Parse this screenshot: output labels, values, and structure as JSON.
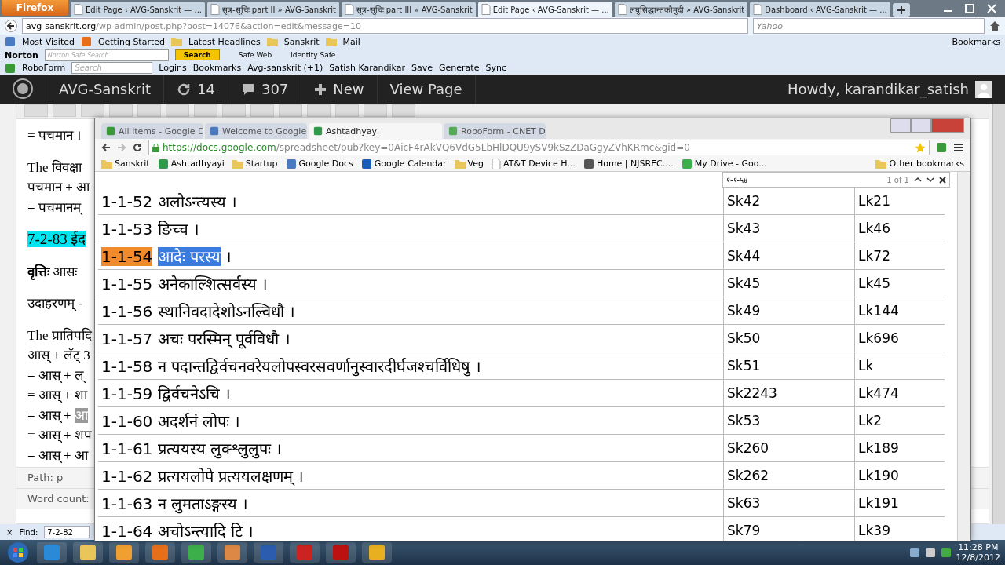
{
  "firefox": {
    "menu_button": "Firefox",
    "tabs": [
      {
        "label": "Edit Page ‹ AVG-Sanskrit — ...",
        "selected": false
      },
      {
        "label": "सूत्र-सूचिः part II » AVG-Sanskrit",
        "selected": false
      },
      {
        "label": "सूत्र-सूचिः part III » AVG-Sanskrit",
        "selected": false
      },
      {
        "label": "Edit Page ‹ AVG-Sanskrit — ...",
        "selected": true
      },
      {
        "label": "लघुसिद्धान्तकौमुदी » AVG-Sanskrit",
        "selected": false
      },
      {
        "label": "Dashboard ‹ AVG-Sanskrit — ...",
        "selected": false
      }
    ],
    "url_host": "avg-sanskrit.org",
    "url_path": "/wp-admin/post.php?post=14076&action=edit&message=10",
    "search_placeholder": "Yahoo",
    "bookmarks": [
      "Most Visited",
      "Getting Started",
      "Latest Headlines",
      "Sanskrit",
      "Mail"
    ],
    "bookmarks_menu": "Bookmarks",
    "norton": {
      "label": "Norton",
      "placeholder": "Norton Safe Search",
      "search_button": "Search",
      "items": [
        "Safe Web",
        "Identity Safe"
      ]
    },
    "roboform": {
      "label": "RoboForm",
      "placeholder": "Search",
      "items": [
        "Logins",
        "Bookmarks",
        "Avg-sanskrit (+1)",
        "Satish Karandikar",
        "Save",
        "Generate",
        "Sync"
      ]
    }
  },
  "admin_bar": {
    "site": "AVG-Sanskrit",
    "updates": "14",
    "comments": "307",
    "new": "New",
    "view": "View Page",
    "howdy": "Howdy, karandikar_satish"
  },
  "editor": {
    "paragraphs": [
      {
        "lines": [
          {
            "text": "= पचमान ।",
            "kind": "plain"
          }
        ]
      },
      {
        "lines": [
          {
            "text": "The विवक्षा",
            "kind": "plain"
          },
          {
            "text": "पचमान + आ",
            "kind": "plain"
          },
          {
            "text": "= पचमानम्",
            "kind": "plain"
          }
        ]
      },
      {
        "lines": [
          {
            "text": "7-2-83 ईद",
            "kind": "highlight"
          }
        ]
      },
      {
        "lines": [
          {
            "text": "**वृत्तिः** आसः",
            "kind": "plain"
          }
        ]
      },
      {
        "lines": [
          {
            "text": "उदाहरणम् -",
            "kind": "plain"
          }
        ]
      },
      {
        "lines": [
          {
            "text": "The प्रातिपदि",
            "kind": "plain"
          },
          {
            "text": "आस् + लँट् 3",
            "kind": "plain"
          },
          {
            "text": "= आस् + ल्",
            "kind": "plain"
          },
          {
            "text": "= आस् + शा",
            "kind": "plain"
          },
          {
            "text": "= आस् +",
            "marked": "आ",
            "kind": "plain"
          },
          {
            "text": "= आस् + शप",
            "kind": "plain"
          },
          {
            "text": "= आस् + आ",
            "kind": "plain"
          }
        ]
      }
    ],
    "path": "Path: p",
    "word_count": "Word count:"
  },
  "find_bar": {
    "close": "×",
    "label": "Find:",
    "value": "7-2-82"
  },
  "chrome": {
    "tabs": [
      {
        "label": "All items - Google D",
        "selected": false
      },
      {
        "label": "Welcome to Google",
        "selected": false
      },
      {
        "label": "Ashtadhyayi",
        "selected": true
      },
      {
        "label": "RoboForm - CNET D",
        "selected": false
      }
    ],
    "url_host": "https://docs.google.com",
    "url_path": "/spreadsheet/pub?key=0AicF4rAkVQ6VdG5LbHlDQU9ySV9kSzZDaGgyZVhKRmc&gid=0",
    "bookmarks": [
      "Sanskrit",
      "Ashtadhyayi",
      "Startup",
      "Google Docs",
      "Google Calendar",
      "Veg",
      "AT&T Device H...",
      "Home | NJSREC....",
      "My Drive - Goo..."
    ],
    "other_bookmarks": "Other bookmarks",
    "find": {
      "value": "१-१-५४",
      "count": "1 of 1"
    },
    "rows": [
      {
        "number": "1-1-52",
        "sutra": "अलोऽन्त्यस्य",
        "end": "।",
        "sk": "Sk42",
        "lk": "Lk21",
        "selected": false
      },
      {
        "number": "1-1-53",
        "sutra": "ङिच्च",
        "end": "।",
        "sk": "Sk43",
        "lk": "Lk46",
        "selected": false
      },
      {
        "number": "1-1-54",
        "sutra": "आदेः परस्य",
        "end": "।",
        "sk": "Sk44",
        "lk": "Lk72",
        "selected": true
      },
      {
        "number": "1-1-55",
        "sutra": "अनेकाल्शित्सर्वस्य",
        "end": "।",
        "sk": "Sk45",
        "lk": "Lk45",
        "selected": false
      },
      {
        "number": "1-1-56",
        "sutra": "स्थानिवदादेशोऽनल्विधौ",
        "end": "।",
        "sk": "Sk49",
        "lk": "Lk144",
        "selected": false
      },
      {
        "number": "1-1-57",
        "sutra": "अचः परस्मिन् पूर्वविधौ",
        "end": "।",
        "sk": "Sk50",
        "lk": "Lk696",
        "selected": false
      },
      {
        "number": "1-1-58",
        "sutra": "न पदान्तद्विर्वचनवरेयलोपस्वरसवर्णानुस्वारदीर्घजश्चर्विधिषु",
        "end": "।",
        "sk": "Sk51",
        "lk": "Lk",
        "selected": false
      },
      {
        "number": "1-1-59",
        "sutra": "द्विर्वचनेऽचि",
        "end": "।",
        "sk": "Sk2243",
        "lk": "Lk474",
        "selected": false
      },
      {
        "number": "1-1-60",
        "sutra": "अदर्शनं लोपः",
        "end": "।",
        "sk": "Sk53",
        "lk": "Lk2",
        "selected": false
      },
      {
        "number": "1-1-61",
        "sutra": "प्रत्ययस्य लुक्श्लुलुपः",
        "end": "।",
        "sk": "Sk260",
        "lk": "Lk189",
        "selected": false
      },
      {
        "number": "1-1-62",
        "sutra": "प्रत्ययलोपे प्रत्ययलक्षणम्",
        "end": "।",
        "sk": "Sk262",
        "lk": "Lk190",
        "selected": false
      },
      {
        "number": "1-1-63",
        "sutra": "न लुमताऽङ्गस्य",
        "end": "।",
        "sk": "Sk63",
        "lk": "Lk191",
        "selected": false
      },
      {
        "number": "1-1-64",
        "sutra": "अचोऽन्त्यादि टि",
        "end": "।",
        "sk": "Sk79",
        "lk": "Lk39",
        "selected": false
      }
    ]
  },
  "taskbar": {
    "time": "11:28 PM",
    "date": "12/8/2012"
  }
}
